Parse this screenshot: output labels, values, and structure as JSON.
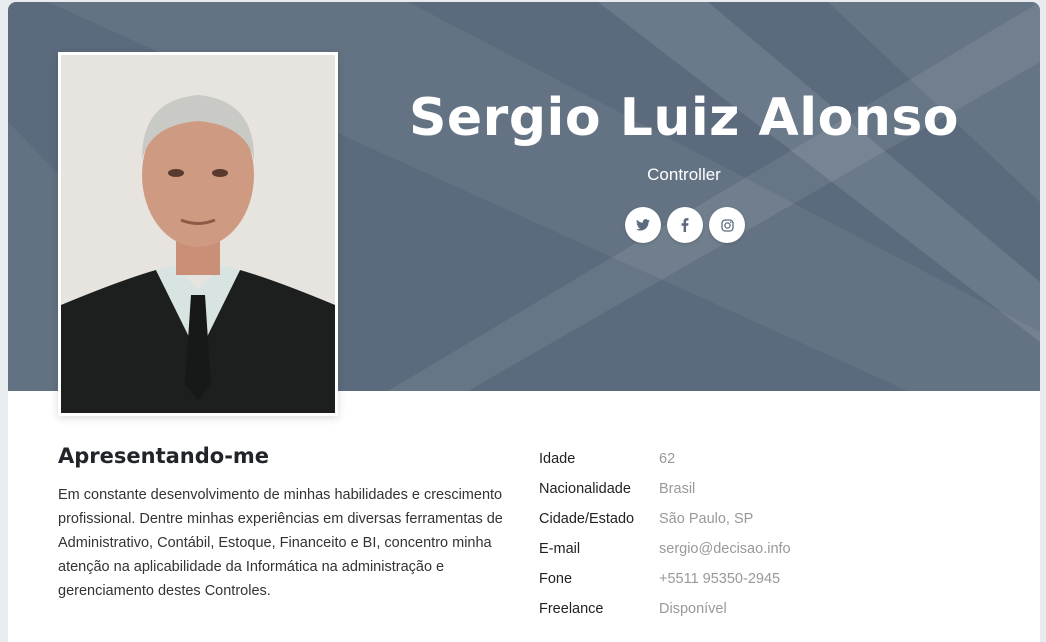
{
  "profile": {
    "name": "Sergio Luiz Alonso",
    "role": "Controller"
  },
  "social": {
    "twitter": "twitter-icon",
    "facebook": "facebook-icon",
    "instagram": "instagram-icon"
  },
  "about": {
    "title": "Apresentando-me",
    "text": "Em constante desenvolvimento de minhas habilidades e crescimento profissional. Dentre minhas experiências em diversas ferramentas de Administrativo, Contábil, Estoque, Financeito e BI, concentro minha atenção na aplicabilidade da Informática na administração e gerenciamento destes Controles."
  },
  "info": [
    {
      "label": "Idade",
      "value": "62"
    },
    {
      "label": "Nacionalidade",
      "value": "Brasil"
    },
    {
      "label": "Cidade/Estado",
      "value": "São Paulo, SP"
    },
    {
      "label": "E-mail",
      "value": "sergio@decisao.info"
    },
    {
      "label": "Fone",
      "value": "+5511 95350-2945"
    },
    {
      "label": "Freelance",
      "value": "Disponível"
    }
  ],
  "colors": {
    "hero": "#5b6b7d",
    "label": "#222222",
    "value": "#999999"
  }
}
